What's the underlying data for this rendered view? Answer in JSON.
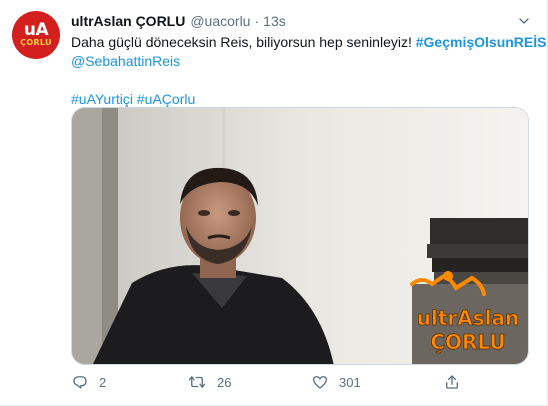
{
  "tweet": {
    "display_name": "ultrAslan ÇORLU",
    "handle": "@uacorlu",
    "separator": "·",
    "time": "13s",
    "avatar": {
      "top": "uA",
      "bottom": "ÇORLU"
    },
    "text_line1": "Daha güçlü döneceksin Reis, biliyorsun hep seninleyiz! ",
    "hashtag1": "#GeçmişOlsunREİS",
    "mention": "@SebahattinReis",
    "hashtag2": "#uAYurtiçi",
    "hashtag3": "#uAÇorlu",
    "media_watermark": {
      "top": "ultrAslan",
      "bottom": "ÇORLU"
    },
    "actions": {
      "reply_count": "2",
      "retweet_count": "26",
      "like_count": "301"
    }
  },
  "colors": {
    "link": "#1b95e0",
    "secondary": "#5b7083",
    "avatar_red": "#d41f1f",
    "watermark_orange": "#ff8a00"
  },
  "icons": [
    "reply-icon",
    "retweet-icon",
    "like-icon",
    "share-icon",
    "caret-down-icon"
  ]
}
